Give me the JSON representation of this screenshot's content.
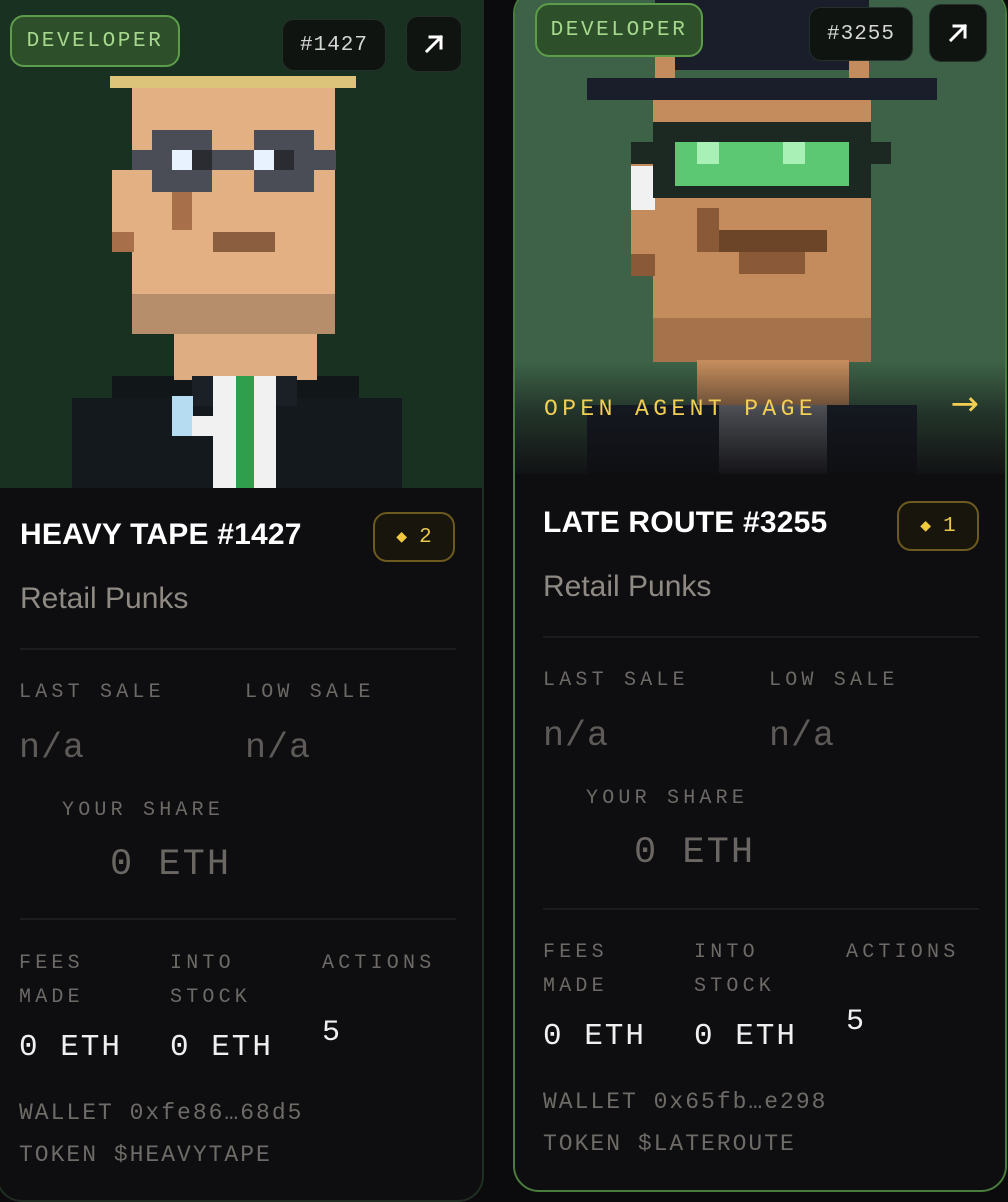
{
  "theme": {
    "card_bg": "#0e0e11",
    "accent_green": "#5c9c4a",
    "accent_gold": "#f2cf52",
    "art_bg_card1": "#183121",
    "art_bg_card2": "#3d6247"
  },
  "cards": [
    {
      "role_badge": "DEVELOPER",
      "number_badge": "#1427",
      "open_icon": "arrow-up-right-icon",
      "name": "HEAVY TAPE #1427",
      "rank_icon": "diamond-icon",
      "rank_value": "2",
      "collection": "Retail Punks",
      "labels": {
        "last_sale": "LAST SALE",
        "low_sale": "LOW SALE",
        "your_share": "YOUR SHARE",
        "fees_made": "FEES\nMADE",
        "into_stock": "INTO\nSTOCK",
        "actions": "ACTIONS"
      },
      "values": {
        "last_sale": "n/a",
        "low_sale": "n/a",
        "your_share": "0 ETH",
        "fees_made": "0 ETH",
        "into_stock": "0 ETH",
        "actions": "5"
      },
      "wallet": "WALLET 0xfe86…68d5",
      "token": "TOKEN $HEAVYTAPE"
    },
    {
      "role_badge": "DEVELOPER",
      "number_badge": "#3255",
      "open_icon": "arrow-up-right-icon",
      "open_agent_label": "OPEN AGENT PAGE",
      "open_agent_arrow": "→",
      "name": "LATE ROUTE #3255",
      "rank_icon": "diamond-icon",
      "rank_value": "1",
      "collection": "Retail Punks",
      "labels": {
        "last_sale": "LAST SALE",
        "low_sale": "LOW SALE",
        "your_share": "YOUR SHARE",
        "fees_made": "FEES\nMADE",
        "into_stock": "INTO\nSTOCK",
        "actions": "ACTIONS"
      },
      "values": {
        "last_sale": "n/a",
        "low_sale": "n/a",
        "your_share": "0 ETH",
        "fees_made": "0 ETH",
        "into_stock": "0 ETH",
        "actions": "5"
      },
      "wallet": "WALLET 0x65fb…e298",
      "token": "TOKEN $LATEROUTE"
    }
  ]
}
